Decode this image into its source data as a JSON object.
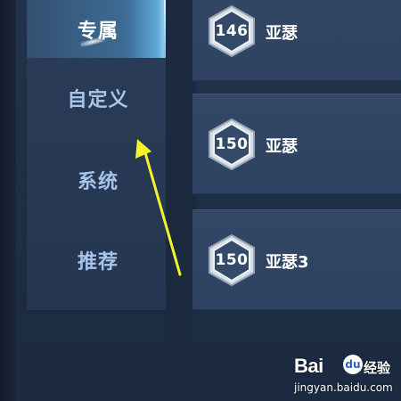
{
  "sidebar": {
    "tabs": [
      {
        "label": "专属",
        "active": true
      },
      {
        "label": "自定义",
        "active": false
      },
      {
        "label": "系统",
        "active": false
      },
      {
        "label": "推荐",
        "active": false
      }
    ]
  },
  "cards": [
    {
      "score": "146",
      "name": "亚瑟"
    },
    {
      "score": "150",
      "name": "亚瑟"
    },
    {
      "score": "150",
      "name": "亚瑟3"
    }
  ],
  "annotation": {
    "arrow_color": "#f7f42a"
  },
  "watermark": {
    "logo": "Bai",
    "logo_mark": "du",
    "brand": "经验",
    "url": "jingyan.baidu.com"
  },
  "colors": {
    "accent": "#5fa8d8",
    "tab_text": "#a9c4ea",
    "card_bg": "#324866"
  }
}
